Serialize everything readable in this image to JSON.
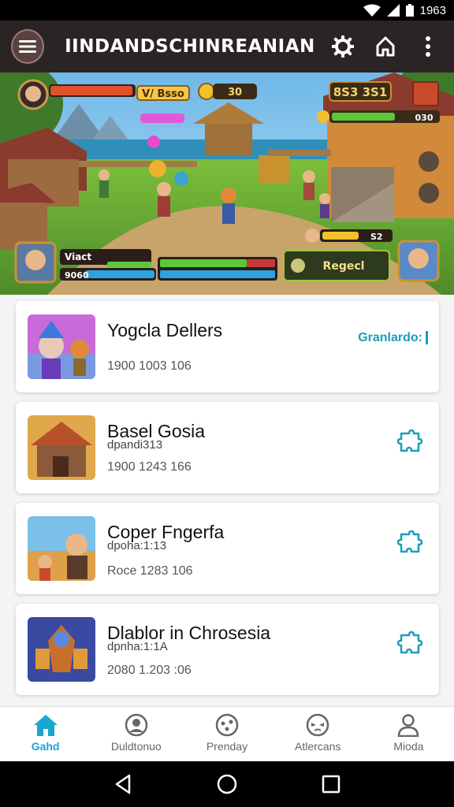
{
  "status_bar": {
    "time": "1963"
  },
  "app_bar": {
    "title": "IINDANDSCHINREANIAN",
    "actions": [
      "settings-icon",
      "home-icon",
      "more-vertical-icon"
    ]
  },
  "banner": {
    "hud": {
      "level_label": "V/ Bsso",
      "coins": "30",
      "score": "8S3 3S1",
      "enemy_value": "030",
      "player_name": "Viact",
      "player_value": "9060",
      "xp_value": "S2",
      "action_button": "Regecl"
    }
  },
  "games": [
    {
      "title": "Yogcla Dellers",
      "subtitle": "",
      "meta": "1900 1003 106",
      "link": "Granlardo:",
      "action": ""
    },
    {
      "title": "Basel Gosia",
      "subtitle": "dpandi313",
      "meta": "1900 1243 166",
      "link": "",
      "action": "puzzle-icon"
    },
    {
      "title": "Coper Fngerfa",
      "subtitle": "dpoha:1:13",
      "meta": "Roce 1283 106",
      "link": "",
      "action": "puzzle-icon"
    },
    {
      "title": "Dlablor in Chrosesia",
      "subtitle": "dpnha:1:1A",
      "meta": "2080 1.203 :06",
      "link": "",
      "action": "puzzle-icon"
    }
  ],
  "bottom_nav": [
    {
      "label": "Gahd",
      "icon": "home-icon",
      "active": true
    },
    {
      "label": "Duldtonuo",
      "icon": "profile-icon",
      "active": false
    },
    {
      "label": "Prenday",
      "icon": "face-icon",
      "active": false
    },
    {
      "label": "Atlercans",
      "icon": "mask-icon",
      "active": false
    },
    {
      "label": "Mioda",
      "icon": "user-icon",
      "active": false
    }
  ],
  "colors": {
    "accent": "#1aa7cf",
    "app_bar": "#2b2424",
    "link": "#1a9fb8"
  }
}
